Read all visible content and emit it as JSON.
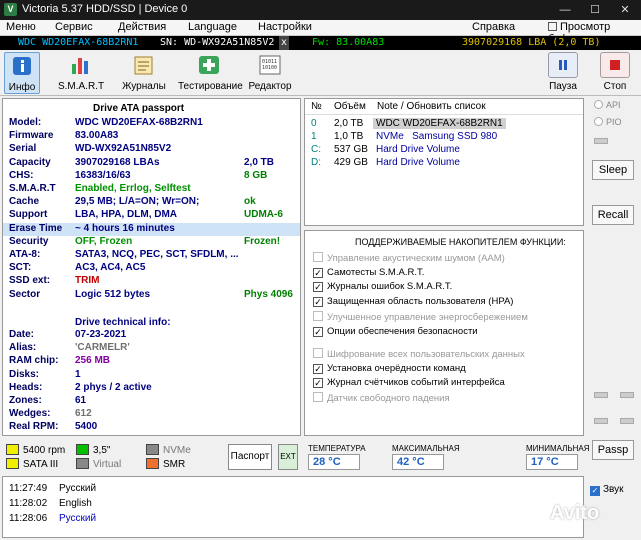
{
  "window": {
    "title": "Victoria 5.37 HDD/SSD | Device 0",
    "min": "—",
    "max": "☐",
    "close": "✕"
  },
  "menu": [
    "Меню",
    "Сервис",
    "Действия",
    "Language",
    "Настройки",
    "Справка",
    "Просмотр буфера"
  ],
  "devbar": {
    "model": "WDC WD20EFAX-68B2RN1",
    "sn": "SN: WD-WX92A51N85V2",
    "fw": "Fw: 83.00A83",
    "lba": "3907029168 LBA (2,0 TB)",
    "close": "x"
  },
  "toolbar": [
    "Инфо",
    "S.M.A.R.T",
    "Журналы",
    "Тестирование",
    "Редактор",
    "Пауза",
    "Стоп"
  ],
  "passport": {
    "title": "Drive ATA passport",
    "rows": [
      {
        "k": "Model:",
        "v": "WDC WD20EFAX-68B2RN1",
        "v2": ""
      },
      {
        "k": "Firmware",
        "v": "83.00A83",
        "v2": ""
      },
      {
        "k": "Serial",
        "v": "WD-WX92A51N85V2",
        "v2": ""
      },
      {
        "k": "Capacity",
        "v": "3907029168 LBAs",
        "v2": "2,0 TB"
      },
      {
        "k": "CHS:",
        "v": "16383/16/63",
        "v2": "8 GB"
      },
      {
        "k": "S.M.A.R.T",
        "v": "Enabled, Errlog, Selftest",
        "v2": ""
      },
      {
        "k": "Cache",
        "v": "29,5 MB; L/A=ON; Wr=ON;",
        "v2": "ok"
      },
      {
        "k": "Support",
        "v": "LBA, HPA, DLM, DMA",
        "v2": "UDMA-6"
      },
      {
        "k": "Erase Time",
        "v": "~ 4 hours 16 minutes",
        "v2": ""
      },
      {
        "k": "Security",
        "v": "OFF, Frozen",
        "v2": "Frozen!"
      },
      {
        "k": "ATA-8:",
        "v": "SATA3, NCQ, PEC, SCT, SFDLM, ...",
        "v2": ""
      },
      {
        "k": "SCT:",
        "v": "AC3, AC4, AC5",
        "v2": ""
      },
      {
        "k": "SSD ext:",
        "v": "TRIM",
        "v2": ""
      },
      {
        "k": "Sector",
        "v": "Logic 512 bytes",
        "v2": "Phys 4096"
      }
    ],
    "tech_title": "Drive technical info:",
    "tech": [
      {
        "k": "Date:",
        "v": "07-23-2021"
      },
      {
        "k": "Alias:",
        "v": "'CARMELR'"
      },
      {
        "k": "RAM chip:",
        "v": "256 MB"
      },
      {
        "k": "Disks:",
        "v": "1"
      },
      {
        "k": "Heads:",
        "v": "2 phys / 2 active"
      },
      {
        "k": "Zones:",
        "v": "61"
      },
      {
        "k": "Wedges:",
        "v": "612"
      },
      {
        "k": "Real RPM:",
        "v": "5400"
      }
    ]
  },
  "devices": {
    "headers": [
      "№",
      "Объём",
      "Note / Обновить список"
    ],
    "rows": [
      [
        "0",
        "2,0 TB",
        "WDC WD20EFAX-68B2RN1"
      ],
      [
        "1",
        "1,0 TB",
        "NVMe   Samsung SSD 980"
      ],
      [
        "C:",
        "537 GB",
        "Hard Drive Volume"
      ],
      [
        "D:",
        "429 GB",
        "Hard Drive Volume"
      ]
    ]
  },
  "features": {
    "title": "ПОДДЕРЖИВАЕМЫЕ НАКОПИТЕЛЕМ ФУНКЦИИ:",
    "items": [
      {
        "label": "Управление акустическим шумом (AAM)",
        "checked": false,
        "enabled": false
      },
      {
        "label": "Самотесты S.M.A.R.T.",
        "checked": true,
        "enabled": true
      },
      {
        "label": "Журналы ошибок S.M.A.R.T.",
        "checked": true,
        "enabled": true
      },
      {
        "label": "Защищенная область пользователя (HPA)",
        "checked": true,
        "enabled": true
      },
      {
        "label": "Улучшенное управление энергосбережением",
        "checked": false,
        "enabled": false
      },
      {
        "label": "Опции обеспечения безопасности",
        "checked": true,
        "enabled": true
      },
      {
        "label": "Шифрование всех пользовательских данных",
        "checked": false,
        "enabled": false
      },
      {
        "label": "Установка очерёдности команд",
        "checked": true,
        "enabled": true
      },
      {
        "label": "Журнал счётчиков событий интерфейса",
        "checked": true,
        "enabled": true
      },
      {
        "label": "Датчик свободного падения",
        "checked": false,
        "enabled": false
      }
    ]
  },
  "temps": {
    "temp_label": "ТЕМПЕРАТУРА",
    "temp": "28 °C",
    "max_label": "МАКСИМАЛЬНАЯ",
    "max": "42 °C",
    "min_label": "МИНИМАЛЬНАЯ",
    "min": "17 °C"
  },
  "legend": [
    {
      "label": "5400 rpm",
      "color": "#f0f000"
    },
    {
      "label": "3,5\"",
      "color": "#00c000"
    },
    {
      "label": "NVMe",
      "color": "#888888"
    },
    {
      "label": "SATA III",
      "color": "#f0f000"
    },
    {
      "label": "Virtual",
      "color": "#888888"
    },
    {
      "label": "SMR",
      "color": "#f07030"
    }
  ],
  "buttons": {
    "passport": "Паспорт",
    "ext": "EXT",
    "sleep": "Sleep",
    "recall": "Recall",
    "passp": "Passp",
    "api": "API",
    "pio": "PIO"
  },
  "log": [
    {
      "t": "11:27:49",
      "m": "Русский",
      "c": "#000000"
    },
    {
      "t": "11:28:02",
      "m": "English",
      "c": "#000000"
    },
    {
      "t": "11:28:06",
      "m": "Русский",
      "c": "#0000c0"
    }
  ],
  "sound": "Звук",
  "watermark": "Avito"
}
